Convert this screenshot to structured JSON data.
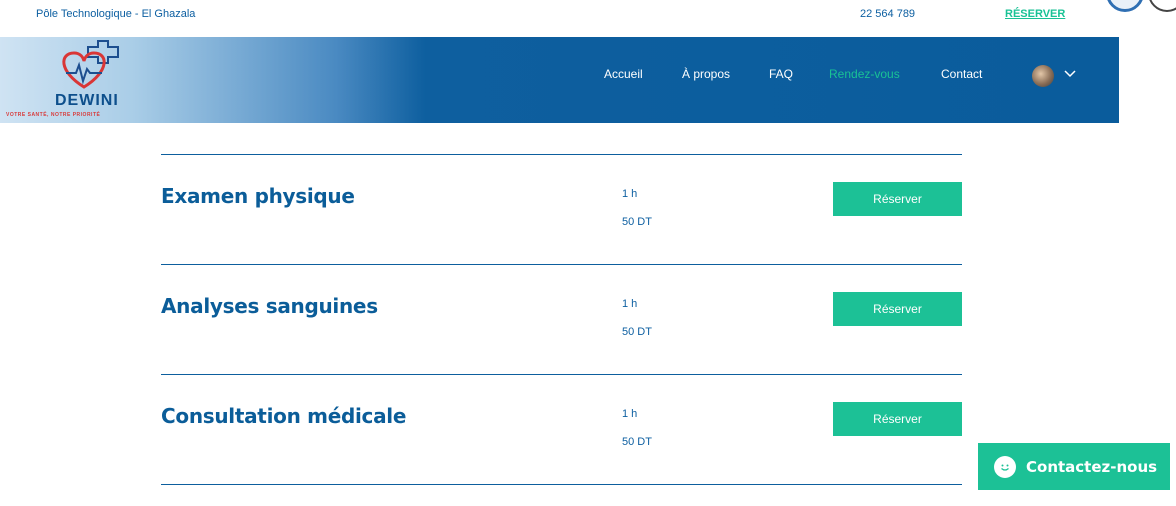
{
  "topbar": {
    "location": "Pôle Technologique - El Ghazala",
    "phone": "22 564 789",
    "reserve_link": "RÉSERVER"
  },
  "brand": {
    "name": "DEWINI",
    "tagline": "VOTRE SANTÉ, NOTRE PRIORITÉ",
    "logo_icon": "heart-cross-icon"
  },
  "nav": {
    "items": [
      {
        "label": "Accueil",
        "active": false
      },
      {
        "label": "À propos",
        "active": false
      },
      {
        "label": "FAQ",
        "active": false
      },
      {
        "label": "Rendez-vous",
        "active": true
      },
      {
        "label": "Contact",
        "active": false
      }
    ],
    "account_icon": "avatar",
    "menu_icon": "chevron-down-icon"
  },
  "services": [
    {
      "name": "Examen physique",
      "duration": "1 h",
      "price": "50 DT",
      "button": "Réserver"
    },
    {
      "name": "Analyses sanguines",
      "duration": "1 h",
      "price": "50 DT",
      "button": "Réserver"
    },
    {
      "name": "Consultation médicale",
      "duration": "1 h",
      "price": "50 DT",
      "button": "Réserver"
    }
  ],
  "chat_widget": {
    "label": "Contactez-nous",
    "icon": "smile-chat-icon"
  },
  "colors": {
    "primary": "#0b5d99",
    "accent": "#1cc196",
    "nav_bg": "#0a5c9c"
  }
}
